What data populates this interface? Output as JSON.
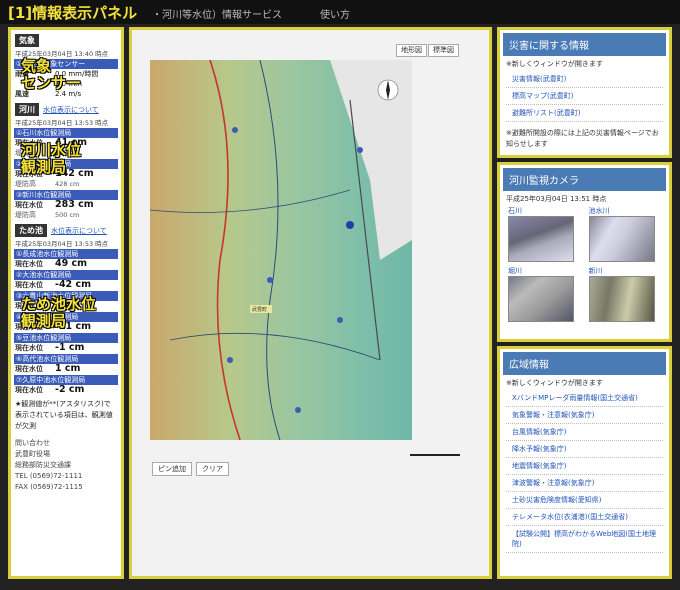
{
  "topbar": {
    "title": "[1]情報表示パネル",
    "subtitle": "・河川等水位）情報サービス",
    "usage": "使い方"
  },
  "left": {
    "weather": {
      "tag": "気象",
      "timestamp": "平成25年03月04日 13:40 時点",
      "station": "①武豊町気象センサー",
      "rows": [
        {
          "k": "雨量",
          "v": "0.0 mm/時間"
        },
        {
          "k": "",
          "v": "0.0 mm"
        },
        {
          "k": "風速",
          "v": "2.4 m/s"
        }
      ]
    },
    "river": {
      "tag": "河川",
      "link": "水位表示について",
      "timestamp": "平成25年03月04日 13:53 時点",
      "stations": [
        {
          "name": "①石川水位観測局",
          "level_k": "現在水位",
          "level": "41 cm",
          "bank_k": "堤防高",
          "bank": "393 cm"
        },
        {
          "name": "②堀川水位観測局",
          "level_k": "現在水位",
          "level": "142 cm",
          "bank_k": "堤防高",
          "bank": "428 cm"
        },
        {
          "name": "③新川水位観測局",
          "level_k": "現在水位",
          "level": "283 cm",
          "bank_k": "堤防高",
          "bank": "500 cm"
        }
      ]
    },
    "pond": {
      "tag": "ため池",
      "link": "水位表示について",
      "timestamp": "平成25年03月04日 13:53 時点",
      "stations": [
        {
          "name": "①長成池水位観測局",
          "level_k": "現在水位",
          "level": "49 cm"
        },
        {
          "name": "②大池水位観測局",
          "level_k": "現在水位",
          "level": "-42 cm"
        },
        {
          "name": "③六貫山新池水位観測局",
          "level_k": "現在水位",
          "level": "0 cm"
        },
        {
          "name": "④別曽池水位観測局",
          "level_k": "現在水位",
          "level": "-11 cm"
        },
        {
          "name": "⑤豆池水位観測局",
          "level_k": "現在水位",
          "level": "-1 cm"
        },
        {
          "name": "⑥高代池水位観測局",
          "level_k": "現在水位",
          "level": "1 cm"
        },
        {
          "name": "⑦久原中池水位観測局",
          "level_k": "現在水位",
          "level": "-2 cm"
        }
      ]
    },
    "note": "★観測値が**(アスタリスク)で表示されている項目は、観測値が欠測",
    "contact": {
      "title": "問い合わせ",
      "org": "武豊町役場",
      "dept": "総務部防災交通課",
      "tel": "TEL (0569)72-1111",
      "fax": "FAX (0569)72-1115"
    },
    "overlays": {
      "weather": "気象\nセンサー",
      "river": "河川水位\n観測局",
      "pond": "ため池水位\n観測局"
    }
  },
  "map": {
    "btn_map": "地形図",
    "btn_std": "標準図",
    "btn_pin": "ピン追加",
    "btn_clear": "クリア",
    "label_town": "武豊町"
  },
  "disaster": {
    "title": "災害に関する情報",
    "note": "※新しくウィンドウが開きます",
    "links": [
      "災害情報(武豊町)",
      "標高マップ(武豊町)",
      "避難所リスト(武豊町)"
    ],
    "text": "※避難所開設の際には上記の災害情報ページでお知らせします"
  },
  "camera": {
    "title": "河川監視カメラ",
    "timestamp": "平成25年03月04日 13:51 時点",
    "cams": [
      "石川",
      "池水川",
      "堀川",
      "新川"
    ]
  },
  "area": {
    "title": "広域情報",
    "note": "※新しくウィンドウが開きます",
    "links": [
      "XバンドMPレーダ雨量情報(国土交通省)",
      "気象警報・注意報(気象庁)",
      "台風情報(気象庁)",
      "降水予報(気象庁)",
      "地震情報(気象庁)",
      "津波警報・注意報(気象庁)",
      "土砂災害危険度情報(愛知県)",
      "テレメータ水位(衣浦港)(国土交通省)",
      "【試験公開】標高がわかるWeb地図(国土地理院)"
    ]
  },
  "colors": {
    "accent": "#d8cf3a",
    "header_blue": "#4a7bb4",
    "station_blue": "#3a5bb8"
  }
}
